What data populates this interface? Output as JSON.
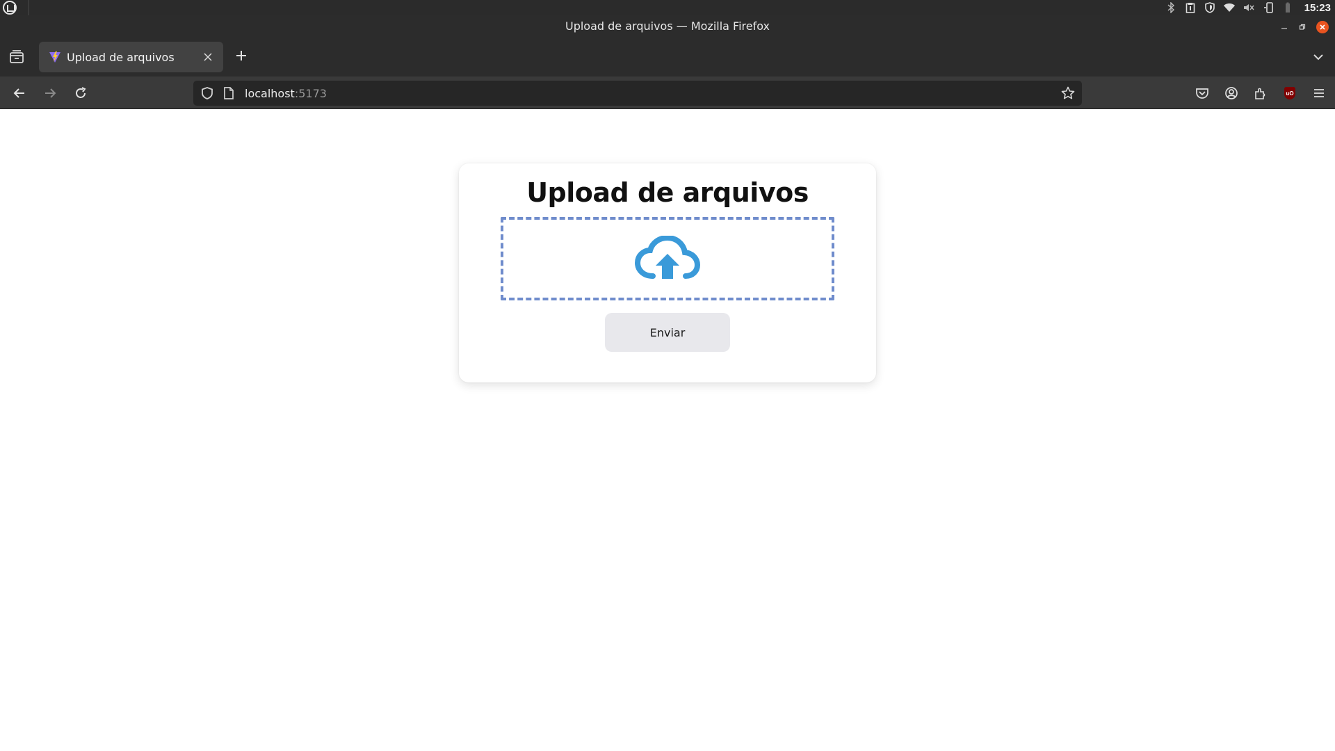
{
  "system": {
    "clock": "15:23"
  },
  "window": {
    "title": "Upload de arquivos — Mozilla Firefox"
  },
  "tabs": [
    {
      "label": "Upload de arquivos",
      "active": true
    }
  ],
  "urlbar": {
    "host": "localhost",
    "port": ":5173"
  },
  "page": {
    "heading": "Upload de arquivos",
    "dropzone_icon": "cloud-upload-icon",
    "send_label": "Enviar"
  },
  "colors": {
    "accent_cloud": "#3a9ad9",
    "dropzone_border": "#6f8ccc",
    "button_bg": "#e8e8ec"
  }
}
